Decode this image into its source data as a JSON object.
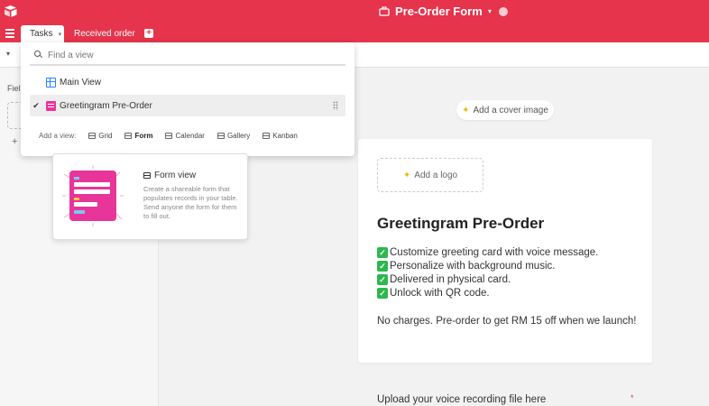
{
  "header": {
    "title": "Pre-Order Form",
    "colors": {
      "brand": "#e5344b"
    }
  },
  "tabs": [
    {
      "label": "Tasks",
      "active": true
    },
    {
      "label": "Received order",
      "active": false
    }
  ],
  "view_switcher": {
    "search_placeholder": "Find a view",
    "search_value": "",
    "views": [
      {
        "label": "Main View",
        "icon": "grid-icon",
        "selected": false
      },
      {
        "label": "Greetingram Pre-Order",
        "icon": "form-icon",
        "selected": true
      }
    ],
    "add_label": "Add a view:",
    "add_options": [
      {
        "label": "Grid",
        "icon": "grid-view-icon"
      },
      {
        "label": "Form",
        "icon": "form-view-icon"
      },
      {
        "label": "Calendar",
        "icon": "calendar-view-icon"
      },
      {
        "label": "Gallery",
        "icon": "gallery-view-icon"
      },
      {
        "label": "Kanban",
        "icon": "kanban-view-icon"
      }
    ]
  },
  "tooltip": {
    "title": "Form view",
    "description": "Create a shareable form that populates records in your table. Send anyone the form for them to fill out."
  },
  "left_panel": {
    "fields_label": "Fiel"
  },
  "form": {
    "cover_button": "Add a cover image",
    "logo_button": "Add a logo",
    "title": "Greetingram Pre-Order",
    "bullets": [
      "Customize greeting card with voice message.",
      "Personalize with background music.",
      "Delivered in physical card.",
      "Unlock with QR code."
    ],
    "description": "No charges. Pre-order to get RM 15 off when we launch!",
    "upload_label": "Upload your voice recording file here",
    "required_marker": "*"
  }
}
